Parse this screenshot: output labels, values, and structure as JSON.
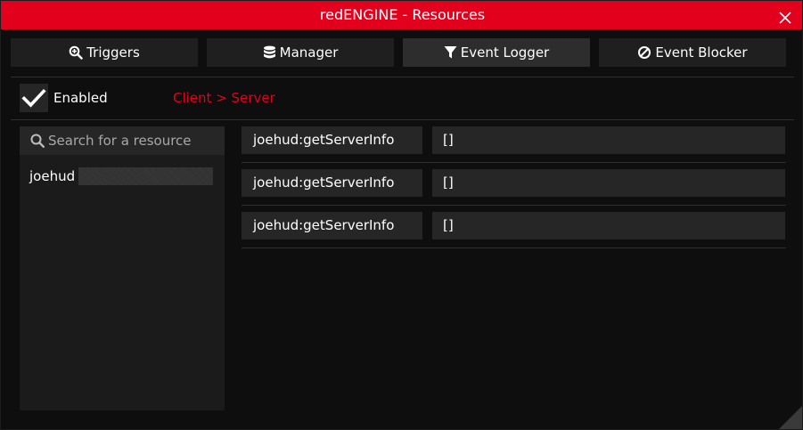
{
  "window": {
    "title": "redENGINE - Resources",
    "accent_color": "#e2001c"
  },
  "tabs": [
    {
      "label": "Triggers",
      "icon": "search-plus-icon",
      "active": false
    },
    {
      "label": "Manager",
      "icon": "database-icon",
      "active": false
    },
    {
      "label": "Event Logger",
      "icon": "filter-icon",
      "active": true
    },
    {
      "label": "Event Blocker",
      "icon": "ban-icon",
      "active": false
    }
  ],
  "logger": {
    "enabled_label": "Enabled",
    "enabled": true,
    "direction_label": "Client > Server",
    "direction_color": "#e2001c"
  },
  "resources": {
    "search_placeholder": "Search for a resource",
    "items": [
      "joehud"
    ]
  },
  "events": [
    {
      "name": "joehud:getServerInfo",
      "args": "[]"
    },
    {
      "name": "joehud:getServerInfo",
      "args": "[]"
    },
    {
      "name": "joehud:getServerInfo",
      "args": "[]"
    }
  ]
}
